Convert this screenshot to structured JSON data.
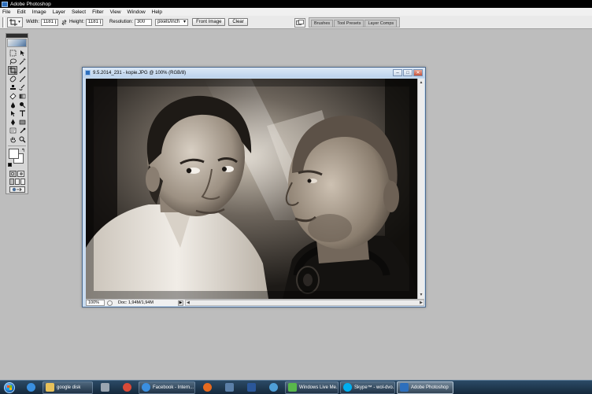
{
  "app": {
    "title": "Adobe Photoshop"
  },
  "menu": [
    "File",
    "Edit",
    "Image",
    "Layer",
    "Select",
    "Filter",
    "View",
    "Window",
    "Help"
  ],
  "options": {
    "width_label": "Width:",
    "width_value": "1181 px",
    "height_label": "Height:",
    "height_value": "1181 px",
    "resolution_label": "Resolution:",
    "resolution_value": "300",
    "resolution_unit": "pixels/inch",
    "front_image_label": "Front Image",
    "clear_label": "Clear"
  },
  "palette_well": {
    "tabs": [
      "Brushes",
      "Tool Presets",
      "Layer Comps"
    ]
  },
  "document": {
    "title": "9.5.2014_231 - kopie.JPG @ 100% (RGB/8)",
    "zoom": "100%",
    "doc_info": "Doc: 1,94M/1,94M"
  },
  "taskbar": {
    "items": [
      {
        "label": "",
        "icon": "ie-icon",
        "color": "#3a8fe0"
      },
      {
        "label": "google disk",
        "icon": "folder-icon",
        "color": "#e8c15a"
      },
      {
        "label": "",
        "icon": "gear-icon",
        "color": "#9aa5b1"
      },
      {
        "label": "",
        "icon": "chrome-icon",
        "color": "#d94a38"
      },
      {
        "label": "Facebook - Intern...",
        "icon": "ie-icon",
        "color": "#3a8fe0"
      },
      {
        "label": "",
        "icon": "firefox-icon",
        "color": "#e66a1f"
      },
      {
        "label": "",
        "icon": "arrow-app-icon",
        "color": "#5b7fa8"
      },
      {
        "label": "",
        "icon": "word-icon",
        "color": "#2b579a"
      },
      {
        "label": "",
        "icon": "globe-icon",
        "color": "#4f9fd8"
      },
      {
        "label": "Windows Live Me...",
        "icon": "messenger-icon",
        "color": "#59b84b"
      },
      {
        "label": "Skype™ - wol-dvo...",
        "icon": "skype-icon",
        "color": "#00aff0"
      },
      {
        "label": "Adobe Photoshop",
        "icon": "photoshop-icon",
        "color": "#2d6fbd"
      }
    ]
  }
}
